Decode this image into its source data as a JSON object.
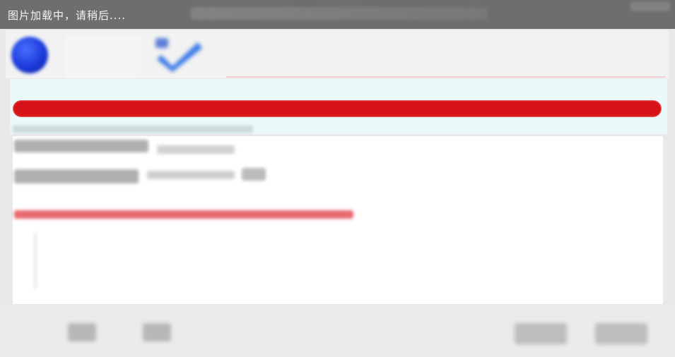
{
  "loading": {
    "message": "图片加载中，请稍后...."
  },
  "progress": {
    "percent": 100,
    "color": "#d61417"
  },
  "colors": {
    "toolbar_icon_primary": "#1a39d9",
    "check_icon": "#3a78e6",
    "note_text": "#dc2832",
    "overlay_bar": "#6e6e6e"
  },
  "icons": {
    "toolbar_left": "blue-circle-icon",
    "toolbar_second": "checkmark-icon"
  }
}
